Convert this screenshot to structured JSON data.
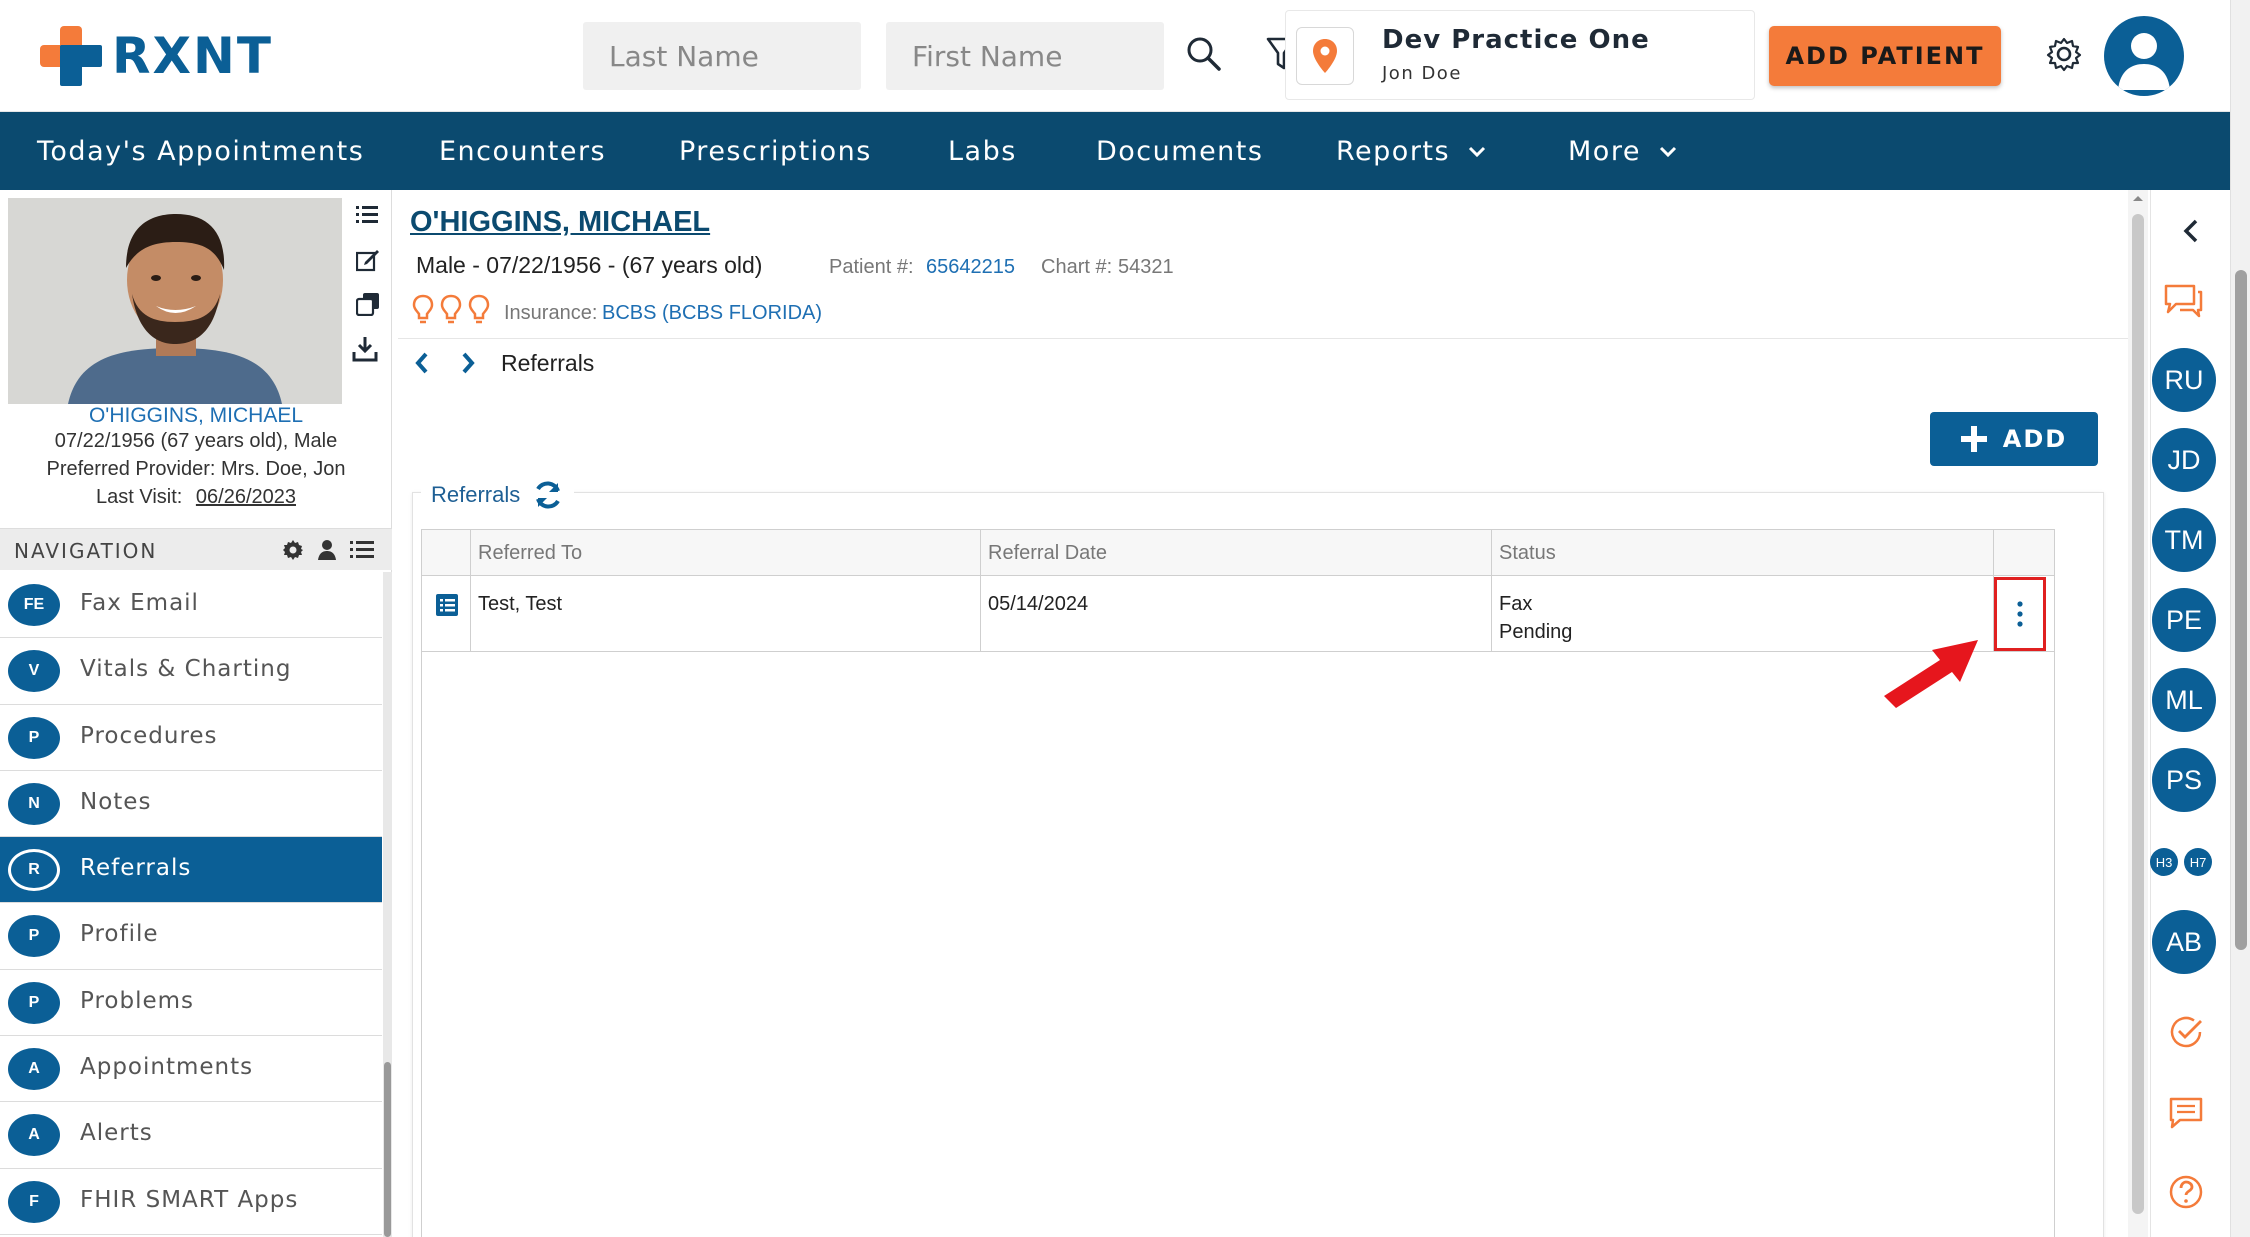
{
  "header": {
    "logo_text": "RXNT",
    "last_name_placeholder": "Last Name",
    "first_name_placeholder": "First Name",
    "practice_name": "Dev Practice One",
    "practice_user": "Jon Doe",
    "add_patient_label": "ADD PATIENT",
    "brand_orange": "#f47b3a",
    "brand_blue": "#0b5f96"
  },
  "navbar": {
    "items": [
      {
        "label": "Today's Appointments"
      },
      {
        "label": "Encounters"
      },
      {
        "label": "Prescriptions"
      },
      {
        "label": "Labs"
      },
      {
        "label": "Documents"
      },
      {
        "label": "Reports"
      },
      {
        "label": "More"
      }
    ]
  },
  "patient_card": {
    "name": "O'HIGGINS, MICHAEL",
    "dob_age_sex": "07/22/1956 (67 years old), Male",
    "preferred_provider": "Preferred Provider: Mrs. Doe, Jon",
    "last_visit_label": "Last Visit:",
    "last_visit_value": "06/26/2023"
  },
  "navigation": {
    "title": "NAVIGATION",
    "items": [
      {
        "badge": "FE",
        "label": "Fax Email"
      },
      {
        "badge": "V",
        "label": "Vitals & Charting"
      },
      {
        "badge": "P",
        "label": "Procedures"
      },
      {
        "badge": "N",
        "label": "Notes"
      },
      {
        "badge": "R",
        "label": "Referrals"
      },
      {
        "badge": "P",
        "label": "Profile"
      },
      {
        "badge": "P",
        "label": "Problems"
      },
      {
        "badge": "A",
        "label": "Appointments"
      },
      {
        "badge": "A",
        "label": "Alerts"
      },
      {
        "badge": "F",
        "label": "FHIR SMART Apps"
      }
    ]
  },
  "main": {
    "patient_name": "O'HIGGINS, MICHAEL",
    "demographics": "Male - 07/22/1956 - (67 years old)",
    "patient_num_label": "Patient #:",
    "patient_num_value": "65642215",
    "chart_num_label": "Chart #:",
    "chart_num_value": "54321",
    "insurance_label": "Insurance:",
    "insurance_value": "BCBS (BCBS FLORIDA)",
    "breadcrumb_title": "Referrals",
    "add_label": "ADD",
    "section_title": "Referrals",
    "table": {
      "columns": [
        "Referred To",
        "Referral Date",
        "Status"
      ],
      "rows": [
        {
          "referred_to": "Test, Test",
          "referral_date": "05/14/2024",
          "status_line1": "Fax",
          "status_line2": "Pending"
        }
      ]
    }
  },
  "rail": {
    "avatars": [
      "RU",
      "JD",
      "TM",
      "PE",
      "ML",
      "PS"
    ],
    "mini": [
      "H3",
      "H7"
    ],
    "bottom_avatar": "AB"
  }
}
